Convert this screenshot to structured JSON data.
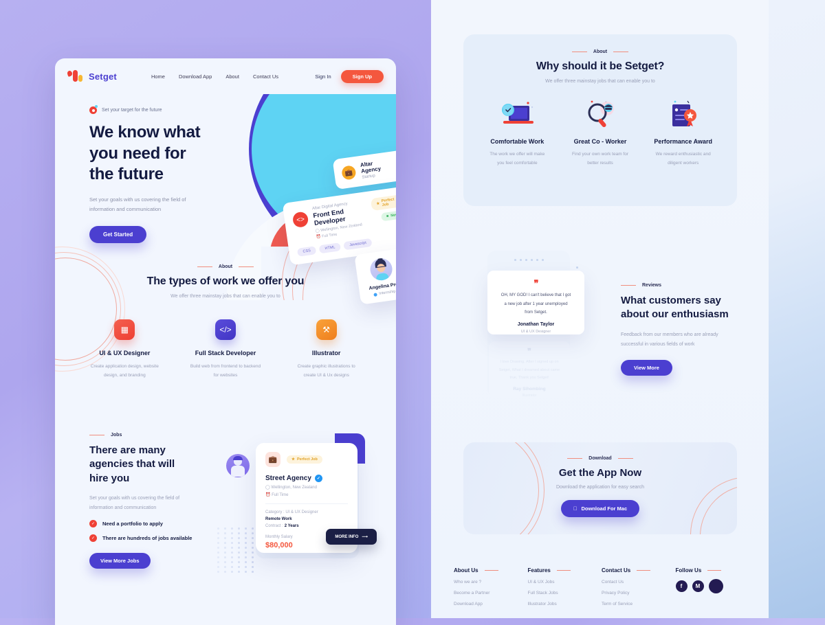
{
  "brand": {
    "name": "Setget"
  },
  "nav": {
    "links": [
      "Home",
      "Download App",
      "About",
      "Contact Us"
    ],
    "sign_in": "Sign In",
    "sign_up": "Sign Up"
  },
  "hero": {
    "eyebrow": "Set your target for the future",
    "title_line1": "We know what",
    "title_line2": "you need for",
    "title_line3": "the future",
    "subtitle_line1": "Set your goals with us covering the field of",
    "subtitle_line2": "information and communication",
    "cta": "Get Started",
    "cards": {
      "agency": {
        "name": "Altar Agency",
        "role": "Startup",
        "check_icon": "check-icon",
        "icon": "briefcase-icon"
      },
      "job": {
        "agency": "Altar Digital Agency",
        "title": "Front End Developer",
        "location": "Wellington, New Zealand",
        "type": "Full Time",
        "badge_perfect": "Perfect Job",
        "badge_new": "New",
        "tags": [
          "CSS",
          "HTML",
          "Javascript"
        ],
        "icon": "html5-icon"
      },
      "person": {
        "name": "Angelina Pro",
        "role": "Internship"
      }
    }
  },
  "about": {
    "label": "About",
    "title": "The types of work we offer you",
    "subtitle": "We offer three mainstay jobs that can enable you to",
    "items": [
      {
        "icon": "layout-grid-icon",
        "name": "UI & UX Designer",
        "desc_line1": "Create application design, website",
        "desc_line2": "design, and branding",
        "color": "#ee3f33"
      },
      {
        "icon": "code-brackets-icon",
        "name": "Full Stack Developer",
        "desc_line1": "Build web from frontend to backend",
        "desc_line2": "for websites",
        "color": "#4b3fd0"
      },
      {
        "icon": "pen-nib-icon",
        "name": "Illustrator",
        "desc_line1": "Create graphic illustrations to",
        "desc_line2": "create UI & Ux designs",
        "color": "#ef7e1c"
      }
    ]
  },
  "jobs": {
    "label": "Jobs",
    "title_line1": "There are many",
    "title_line2": "agencies that will",
    "title_line3": "hire you",
    "subtitle_line1": "Set your goals with us covering the field of",
    "subtitle_line2": "information and communication",
    "checks": [
      "Need a portfolio to apply",
      "There are hundreds of jobs available"
    ],
    "cta": "View More Jobs",
    "card": {
      "badge": "Perfect Job",
      "name": "Street Agency",
      "location": "Wellington, New Zealand",
      "type": "Full Time",
      "category": "Category : UI & UX Designer",
      "remote": "Remote Work",
      "contract_label": "Contract : ",
      "contract_value": "2 Years",
      "salary_label": "Monthly Salary",
      "salary": "$80,000",
      "more_info": "MORE INFO",
      "icon": "briefcase-icon"
    }
  },
  "why": {
    "label": "About",
    "title": "Why should it be Setget?",
    "subtitle": "We offer three mainstay jobs that can enable you to",
    "items": [
      {
        "icon": "laptop-shield-icon",
        "name": "Comfortable Work",
        "desc_line1": "The work we offer will make",
        "desc_line2": "you feel comfortable"
      },
      {
        "icon": "magnifier-person-icon",
        "name": "Great Co - Worker",
        "desc_line1": "Find your own work team for",
        "desc_line2": "better results"
      },
      {
        "icon": "certificate-ribbon-icon",
        "name": "Performance Award",
        "desc_line1": "We reward enthusiastic and",
        "desc_line2": "diligent workers"
      }
    ]
  },
  "reviews": {
    "label": "Reviews",
    "title_line1": "What customers say",
    "title_line2": "about our enthusiasm",
    "subtitle_line1": "Feedback from our members who are already",
    "subtitle_line2": "successful in various fields of work",
    "cta": "View More",
    "testimonial_active": {
      "quote_line1": "OH, MY GOD! I can't believe that I got",
      "quote_line2": "a new job after 1 year unemployed",
      "quote_line3": "from Setget.",
      "name": "Jonathan Taylor",
      "role": "UI & UX Designer"
    },
    "testimonial_faded": {
      "quote_line1": "I love Drawing. After I signed up on",
      "quote_line2": "Setget, What I dreamed about came",
      "quote_line3": "true, Thank you Setget!",
      "name": "Ray Sihombing",
      "role": "Illustrator"
    }
  },
  "download": {
    "label": "Download",
    "title": "Get the App Now",
    "subtitle": "Download the application for easy search",
    "cta": "Download For Mac",
    "cta_icon": "apple-icon"
  },
  "footer": {
    "columns": [
      {
        "head": "About Us",
        "links": [
          "Who we are ?",
          "Become a Partner",
          "Download App"
        ]
      },
      {
        "head": "Features",
        "links": [
          "UI & UX Jobs",
          "Full Stack Jobs",
          "Illustrator Jobs"
        ]
      },
      {
        "head": "Contact Us",
        "links": [
          "Contact Us",
          "Privacy Policy",
          "Term of Service"
        ]
      }
    ],
    "follow": {
      "head": "Follow Us",
      "socials": [
        "facebook-icon",
        "medium-icon",
        "social-icon"
      ]
    }
  },
  "colors": {
    "primary_purple": "#4b3fd0",
    "accent_red": "#f4573e",
    "accent_orange": "#f6a623",
    "cyan": "#5ed3f3",
    "dark": "#141b41",
    "muted": "#9aa0b8"
  }
}
